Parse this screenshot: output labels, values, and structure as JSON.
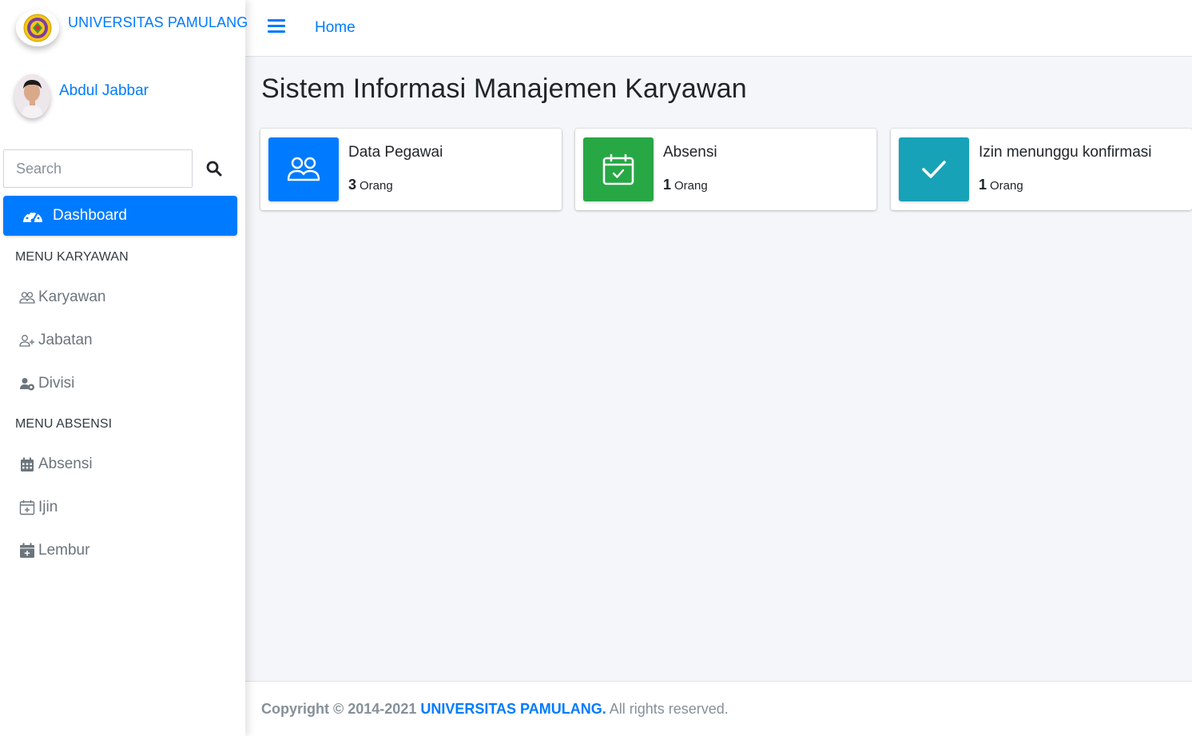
{
  "brand": {
    "name": "UNIVERSITAS PAMULANG",
    "logo_icon": "university-seal-icon"
  },
  "user": {
    "name": "Abdul Jabbar",
    "avatar_icon": "user-avatar"
  },
  "search": {
    "placeholder": "Search",
    "value": "",
    "icon": "search-icon"
  },
  "sidebar": {
    "active": {
      "label": "Dashboard",
      "icon": "dashboard-icon"
    },
    "sections": [
      {
        "header": "MENU KARYAWAN",
        "items": [
          {
            "label": "Karyawan",
            "icon": "users-icon"
          },
          {
            "label": "Jabatan",
            "icon": "user-plus-icon"
          },
          {
            "label": "Divisi",
            "icon": "user-cog-icon"
          }
        ]
      },
      {
        "header": "MENU ABSENSI",
        "items": [
          {
            "label": "Absensi",
            "icon": "calendar-icon"
          },
          {
            "label": "Ijin",
            "icon": "calendar-plus-icon"
          },
          {
            "label": "Lembur",
            "icon": "calendar-plus-filled-icon"
          }
        ]
      }
    ]
  },
  "navbar": {
    "menu_icon": "hamburger-icon",
    "home": "Home"
  },
  "page": {
    "title": "Sistem Informasi Manajemen Karyawan"
  },
  "cards": [
    {
      "title": "Data Pegawai",
      "count": "3",
      "unit": "Orang",
      "color": "#007bff",
      "icon": "people-icon"
    },
    {
      "title": "Absensi",
      "count": "1",
      "unit": "Orang",
      "color": "#28a745",
      "icon": "calendar-check-icon"
    },
    {
      "title": "Izin menunggu konfirmasi",
      "count": "1",
      "unit": "Orang",
      "color": "#17a2b8",
      "icon": "check-icon"
    }
  ],
  "footer": {
    "prefix": "Copyright © 2014-2021",
    "brand": "UNIVERSITAS PAMULANG.",
    "suffix": "All rights reserved."
  },
  "colors": {
    "primary": "#007bff",
    "success": "#28a745",
    "info": "#17a2b8",
    "muted": "#6c757d",
    "background": "#f4f6f9"
  }
}
